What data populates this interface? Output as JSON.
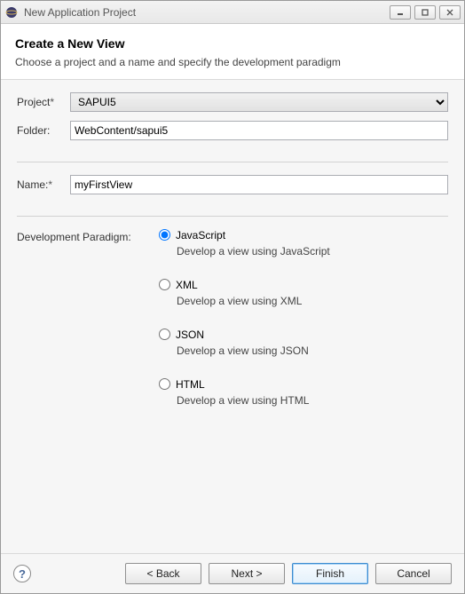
{
  "window": {
    "title": "New Application Project"
  },
  "header": {
    "title": "Create a New View",
    "description": "Choose a project and a name and specify the development paradigm"
  },
  "form": {
    "project_label": "Project",
    "project_value": "SAPUI5",
    "folder_label": "Folder:",
    "folder_value": "WebContent/sapui5",
    "name_label": "Name:",
    "name_value": "myFirstView"
  },
  "paradigm": {
    "label": "Development Paradigm:",
    "options": [
      {
        "value": "js",
        "label": "JavaScript",
        "desc": "Develop a view using JavaScript",
        "selected": true
      },
      {
        "value": "xml",
        "label": "XML",
        "desc": "Develop a view using XML",
        "selected": false
      },
      {
        "value": "json",
        "label": "JSON",
        "desc": "Develop a view using JSON",
        "selected": false
      },
      {
        "value": "html",
        "label": "HTML",
        "desc": "Develop a view using HTML",
        "selected": false
      }
    ]
  },
  "buttons": {
    "back": "< Back",
    "next": "Next >",
    "finish": "Finish",
    "cancel": "Cancel"
  },
  "required_mark": "*"
}
